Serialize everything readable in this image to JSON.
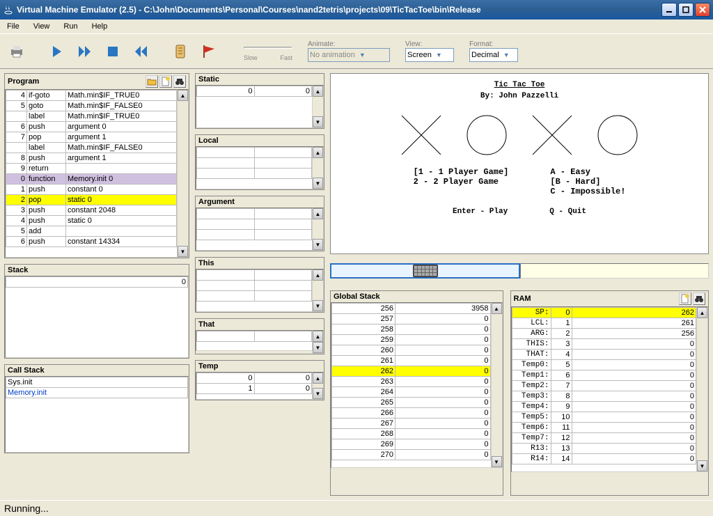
{
  "window": {
    "title": "Virtual Machine Emulator (2.5) - C:\\John\\Documents\\Personal\\Courses\\nand2tetris\\projects\\09\\TicTacToe\\bin\\Release"
  },
  "menu": {
    "file": "File",
    "view": "View",
    "run": "Run",
    "help": "Help"
  },
  "toolbar": {
    "slow": "Slow",
    "fast": "Fast",
    "animate_label": "Animate:",
    "animate_value": "No animation",
    "view_label": "View:",
    "view_value": "Screen",
    "format_label": "Format:",
    "format_value": "Decimal"
  },
  "labels": {
    "program": "Program",
    "static": "Static",
    "local": "Local",
    "argument": "Argument",
    "this": "This",
    "that": "That",
    "temp": "Temp",
    "stack": "Stack",
    "callstack": "Call Stack",
    "global_stack": "Global Stack",
    "ram": "RAM"
  },
  "program": [
    {
      "n": "4",
      "op": "if-goto",
      "arg": "Math.min$IF_TRUE0"
    },
    {
      "n": "5",
      "op": "goto",
      "arg": "Math.min$IF_FALSE0"
    },
    {
      "n": "",
      "op": "label",
      "arg": "Math.min$IF_TRUE0"
    },
    {
      "n": "6",
      "op": "push",
      "arg": "argument 0"
    },
    {
      "n": "7",
      "op": "pop",
      "arg": "argument 1"
    },
    {
      "n": "",
      "op": "label",
      "arg": "Math.min$IF_FALSE0"
    },
    {
      "n": "8",
      "op": "push",
      "arg": "argument 1"
    },
    {
      "n": "9",
      "op": "return",
      "arg": ""
    },
    {
      "n": "0",
      "op": "function",
      "arg": "Memory.init 0",
      "hl": "purple"
    },
    {
      "n": "1",
      "op": "push",
      "arg": "constant 0"
    },
    {
      "n": "2",
      "op": "pop",
      "arg": "static 0",
      "hl": "yellow"
    },
    {
      "n": "3",
      "op": "push",
      "arg": "constant 2048"
    },
    {
      "n": "4",
      "op": "push",
      "arg": "static 0"
    },
    {
      "n": "5",
      "op": "add",
      "arg": ""
    },
    {
      "n": "6",
      "op": "push",
      "arg": "constant 14334"
    }
  ],
  "static": [
    {
      "a": "0",
      "v": "0"
    }
  ],
  "local": [
    {
      "a": "",
      "v": ""
    },
    {
      "a": "",
      "v": ""
    },
    {
      "a": "",
      "v": ""
    }
  ],
  "argument": [
    {
      "a": "",
      "v": ""
    },
    {
      "a": "",
      "v": ""
    },
    {
      "a": "",
      "v": ""
    }
  ],
  "this": [
    {
      "a": "",
      "v": ""
    },
    {
      "a": "",
      "v": ""
    },
    {
      "a": "",
      "v": ""
    }
  ],
  "that": [
    {
      "a": "",
      "v": ""
    }
  ],
  "temp": [
    {
      "a": "0",
      "v": "0"
    },
    {
      "a": "1",
      "v": "0"
    }
  ],
  "stack": [
    {
      "v": "0"
    }
  ],
  "callstack": [
    "Sys.init",
    "Memory.init"
  ],
  "global_stack": [
    {
      "a": "256",
      "v": "3958"
    },
    {
      "a": "257",
      "v": "0"
    },
    {
      "a": "258",
      "v": "0"
    },
    {
      "a": "259",
      "v": "0"
    },
    {
      "a": "260",
      "v": "0"
    },
    {
      "a": "261",
      "v": "0"
    },
    {
      "a": "262",
      "v": "0",
      "hl": true
    },
    {
      "a": "263",
      "v": "0"
    },
    {
      "a": "264",
      "v": "0"
    },
    {
      "a": "265",
      "v": "0"
    },
    {
      "a": "266",
      "v": "0"
    },
    {
      "a": "267",
      "v": "0"
    },
    {
      "a": "268",
      "v": "0"
    },
    {
      "a": "269",
      "v": "0"
    },
    {
      "a": "270",
      "v": "0"
    }
  ],
  "ram": [
    {
      "k": "SP:",
      "a": "0",
      "v": "262",
      "hl": true
    },
    {
      "k": "LCL:",
      "a": "1",
      "v": "261"
    },
    {
      "k": "ARG:",
      "a": "2",
      "v": "256"
    },
    {
      "k": "THIS:",
      "a": "3",
      "v": "0"
    },
    {
      "k": "THAT:",
      "a": "4",
      "v": "0"
    },
    {
      "k": "Temp0:",
      "a": "5",
      "v": "0"
    },
    {
      "k": "Temp1:",
      "a": "6",
      "v": "0"
    },
    {
      "k": "Temp2:",
      "a": "7",
      "v": "0"
    },
    {
      "k": "Temp3:",
      "a": "8",
      "v": "0"
    },
    {
      "k": "Temp4:",
      "a": "9",
      "v": "0"
    },
    {
      "k": "Temp5:",
      "a": "10",
      "v": "0"
    },
    {
      "k": "Temp6:",
      "a": "11",
      "v": "0"
    },
    {
      "k": "Temp7:",
      "a": "12",
      "v": "0"
    },
    {
      "k": "R13:",
      "a": "13",
      "v": "0"
    },
    {
      "k": "R14:",
      "a": "14",
      "v": "0"
    }
  ],
  "screen": {
    "title": "Tic Tac Toe",
    "by": "By: John Pazzelli",
    "p1": "[1 - 1 Player Game]",
    "p2": " 2 - 2 Player Game",
    "a": "A - Easy",
    "b": "[B - Hard]",
    "c": "C - Impossible!",
    "enter": "Enter - Play",
    "quit": "Q - Quit"
  },
  "status": "Running..."
}
